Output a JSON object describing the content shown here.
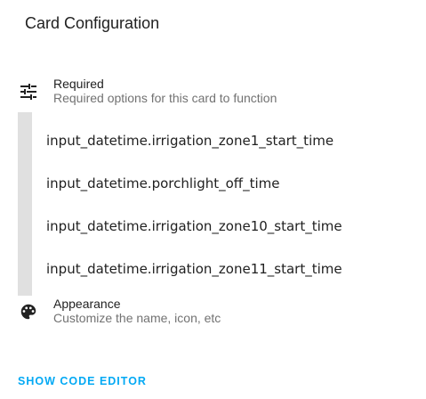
{
  "header": {
    "title": "Card Configuration"
  },
  "sections": {
    "required": {
      "title": "Required",
      "subtitle": "Required options for this card to function",
      "icon": "tune-icon"
    },
    "appearance": {
      "title": "Appearance",
      "subtitle": "Customize the name, icon, etc",
      "icon": "palette-icon"
    }
  },
  "entities": [
    "input_datetime.irrigation_zone1_start_time",
    "input_datetime.porchlight_off_time",
    "input_datetime.irrigation_zone10_start_time",
    "input_datetime.irrigation_zone11_start_time"
  ],
  "actions": {
    "show_code_editor": "SHOW CODE EDITOR"
  },
  "colors": {
    "accent": "#03a9f4",
    "bar": "#e0e0e0",
    "secondary_text": "#727272"
  }
}
